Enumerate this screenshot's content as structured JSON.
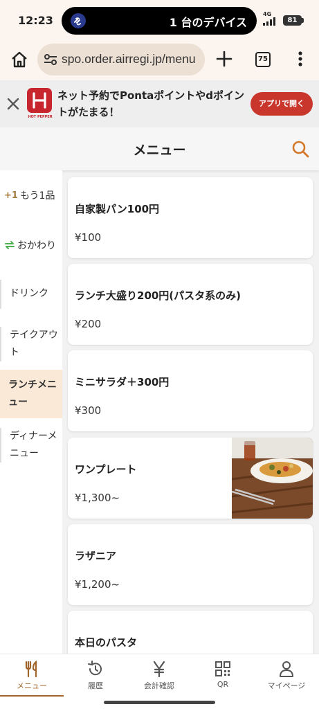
{
  "status_bar": {
    "time": "12:23",
    "island_text": "1 台のデバイス",
    "network": "4G",
    "battery": "81"
  },
  "browser": {
    "url": "spo.order.airregi.jp/menu",
    "tab_count": "75",
    "icons": [
      "home-icon",
      "site-settings-icon",
      "plus-icon",
      "tabs-icon",
      "more-vert-icon"
    ]
  },
  "promo": {
    "text": "ネット予約でPontaポイントやdポイントがたまる！",
    "logo_text": "HOT PEPPER",
    "button_label": "アプリで開く",
    "brand_color": "#c8262f"
  },
  "header": {
    "title": "メニュー"
  },
  "sidebar": {
    "specials": [
      {
        "icon_text": "+1",
        "label": "もう1品"
      },
      {
        "label": "おかわり"
      }
    ],
    "categories": [
      {
        "label": "ドリンク",
        "active": false
      },
      {
        "label": "テイクアウト",
        "active": false
      },
      {
        "label": "ランチメニュー",
        "active": true
      },
      {
        "label": "ディナーメニュー",
        "active": false
      }
    ]
  },
  "menu_items": [
    {
      "name": "自家製パン100円",
      "price": "¥100",
      "has_photo": false
    },
    {
      "name": "ランチ大盛り200円(パスタ系のみ)",
      "price": "¥200",
      "has_photo": false
    },
    {
      "name": "ミニサラダ＋300円",
      "price": "¥300",
      "has_photo": false
    },
    {
      "name": "ワンプレート",
      "price": "¥1,300~",
      "has_photo": true
    },
    {
      "name": "ラザニア",
      "price": "¥1,200~",
      "has_photo": false
    },
    {
      "name": "本日のパスタ",
      "price": "",
      "has_photo": false
    }
  ],
  "bottom_nav": {
    "items": [
      {
        "label": "メニュー",
        "icon": "cutlery-icon",
        "active": true
      },
      {
        "label": "履歴",
        "icon": "history-icon",
        "active": false
      },
      {
        "label": "会計確認",
        "icon": "yen-icon",
        "active": false
      },
      {
        "label": "QR",
        "icon": "qr-code-icon",
        "active": false
      },
      {
        "label": "マイページ",
        "icon": "person-icon",
        "active": false
      }
    ]
  },
  "colors": {
    "accent": "#a0652b",
    "active_category_bg": "#fbe9d8",
    "search_icon": "#d4782a"
  }
}
